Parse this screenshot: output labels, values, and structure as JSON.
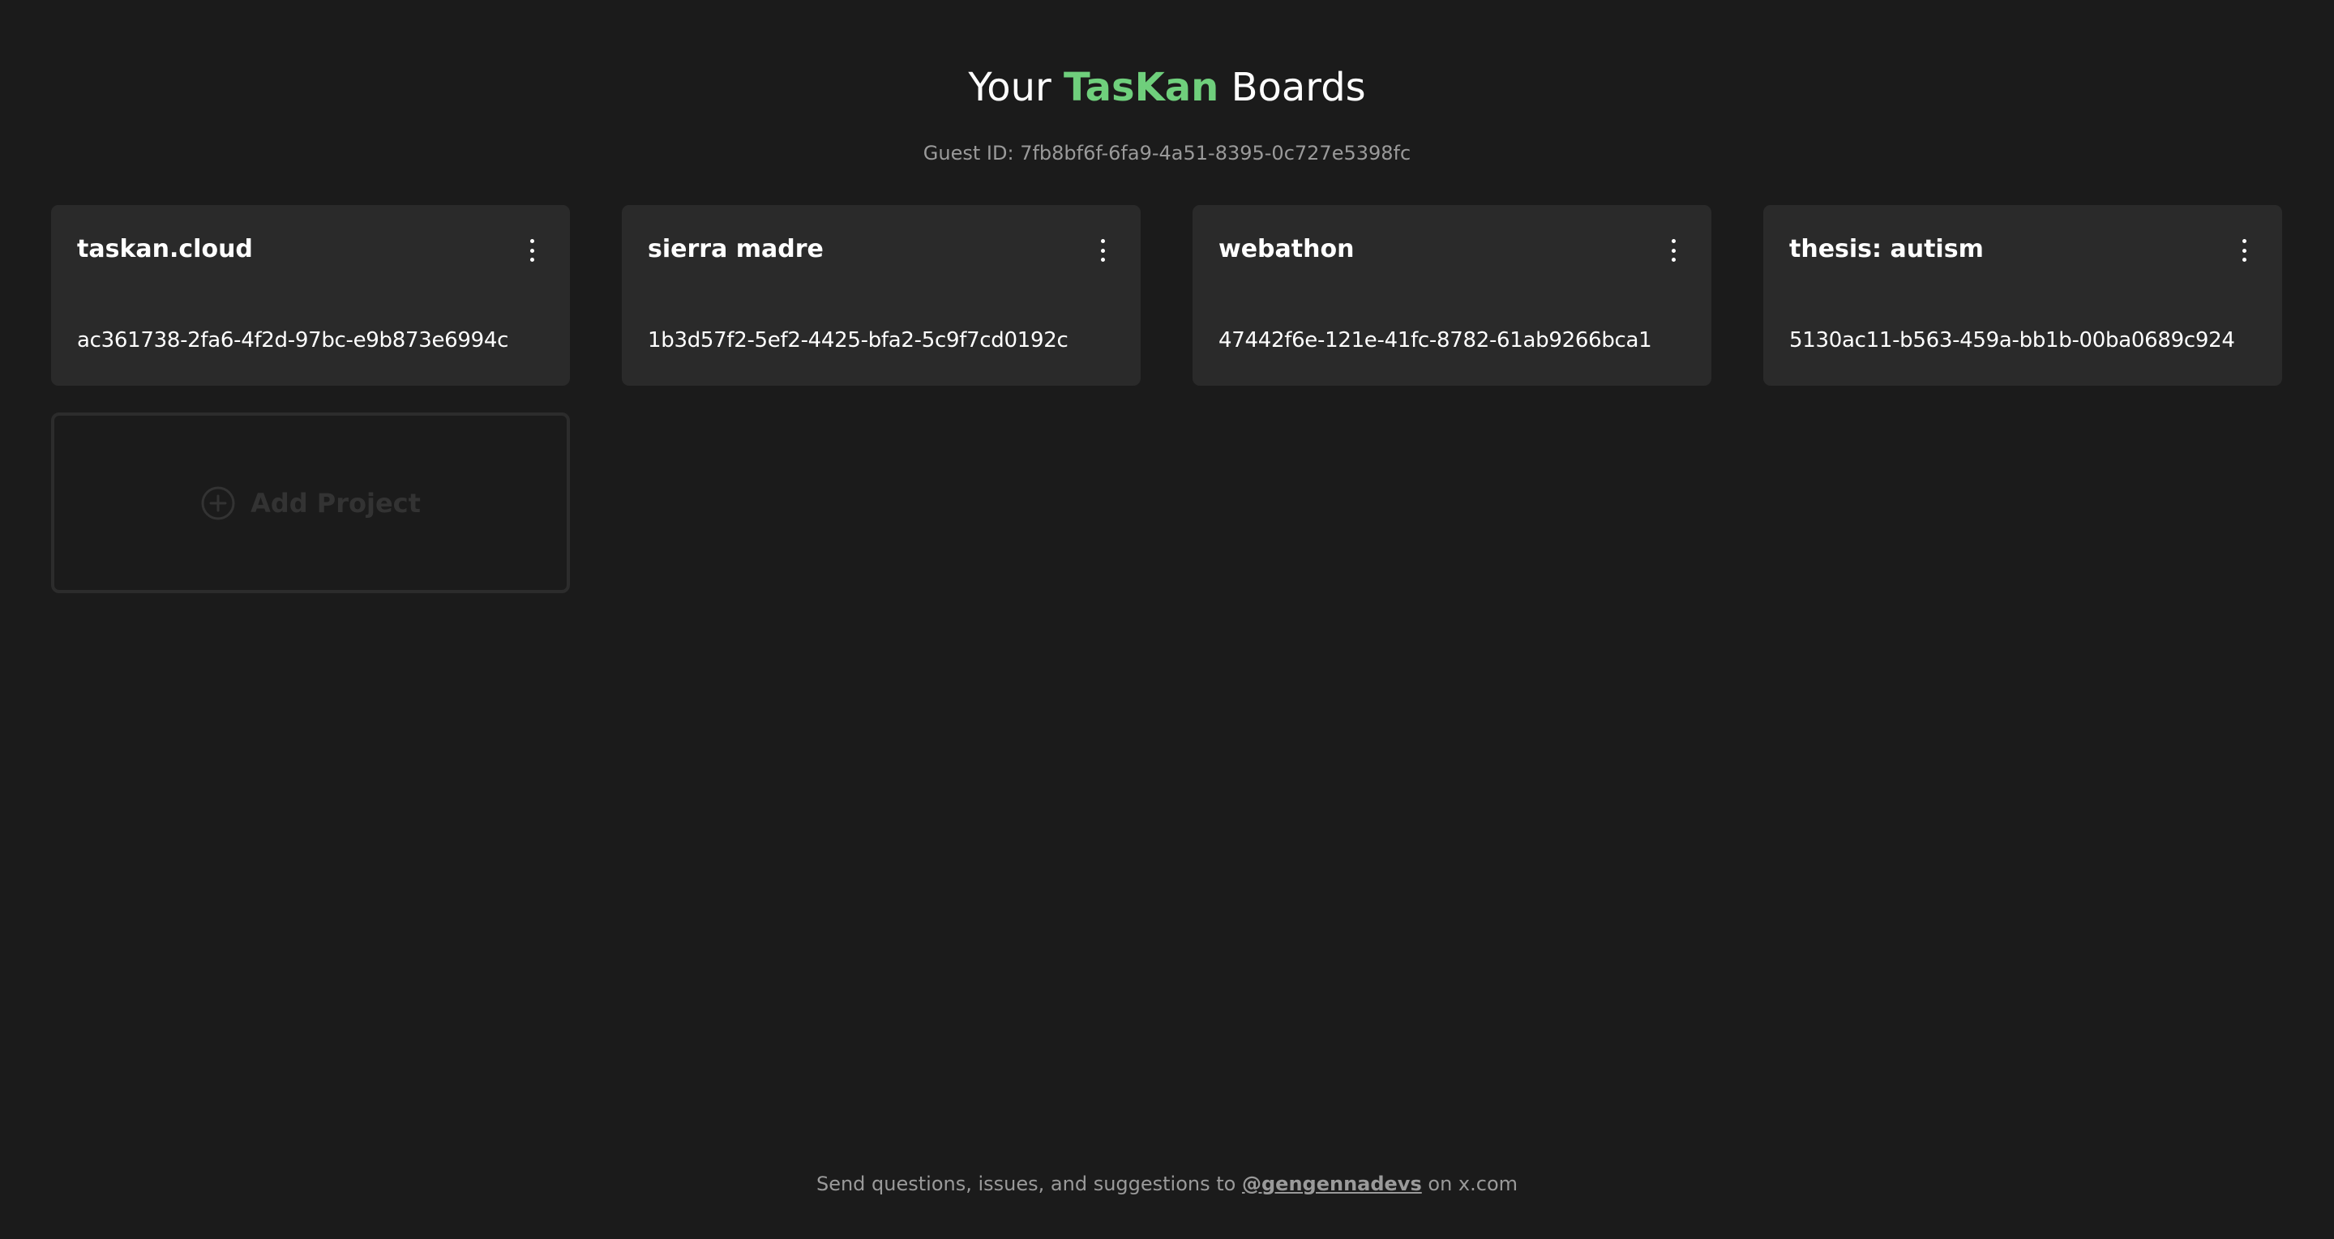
{
  "header": {
    "title_prefix": "Your",
    "title_brand": "TasKan",
    "title_suffix": "Boards",
    "guest_label": "Guest ID:",
    "guest_id": "7fb8bf6f-6fa9-4a51-8395-0c727e5398fc"
  },
  "projects": [
    {
      "name": "taskan.cloud",
      "id": "ac361738-2fa6-4f2d-97bc-e9b873e6994c"
    },
    {
      "name": "sierra madre",
      "id": "1b3d57f2-5ef2-4425-bfa2-5c9f7cd0192c"
    },
    {
      "name": "webathon",
      "id": "47442f6e-121e-41fc-8782-61ab9266bca1"
    },
    {
      "name": "thesis: autism",
      "id": "5130ac11-b563-459a-bb1b-00ba0689c924"
    }
  ],
  "add_project": {
    "label": "Add Project",
    "icon": "plus-circle-icon"
  },
  "card_menu_icon": "more-vertical-icon",
  "footer": {
    "prefix": "Send questions, issues, and suggestions to",
    "handle": "@gengennadevs",
    "suffix": "on x.com"
  },
  "colors": {
    "background": "#1b1b1b",
    "card": "#2a2a2a",
    "brand": "#6fcf7c",
    "muted_text": "#9a9a9a",
    "add_border": "#2c2c2c",
    "add_text": "#333333"
  }
}
